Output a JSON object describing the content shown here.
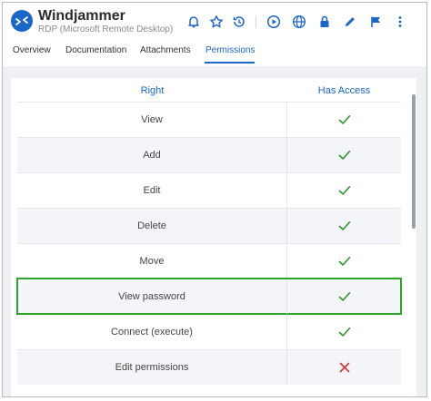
{
  "header": {
    "title": "Windjammer",
    "subtitle": "RDP (Microsoft Remote Desktop)",
    "toolbar_icons": [
      "bell-icon",
      "star-icon",
      "history-icon",
      "play-icon",
      "globe-icon",
      "lock-icon",
      "pencil-icon",
      "flag-icon",
      "more-vertical-icon"
    ]
  },
  "tabs": [
    {
      "label": "Overview",
      "active": false
    },
    {
      "label": "Documentation",
      "active": false
    },
    {
      "label": "Attachments",
      "active": false
    },
    {
      "label": "Permissions",
      "active": true
    }
  ],
  "table": {
    "columns": {
      "right": "Right",
      "access": "Has Access"
    },
    "rows": [
      {
        "right": "View",
        "has_access": true
      },
      {
        "right": "Add",
        "has_access": true
      },
      {
        "right": "Edit",
        "has_access": true
      },
      {
        "right": "Delete",
        "has_access": true
      },
      {
        "right": "Move",
        "has_access": true
      },
      {
        "right": "View password",
        "has_access": true,
        "highlighted": true
      },
      {
        "right": "Connect (execute)",
        "has_access": true
      },
      {
        "right": "Edit permissions",
        "has_access": false
      }
    ]
  },
  "colors": {
    "accent": "#1b66c9",
    "check": "#2e9a2e",
    "cross": "#d9302c",
    "highlight_border": "#2aa52a"
  }
}
